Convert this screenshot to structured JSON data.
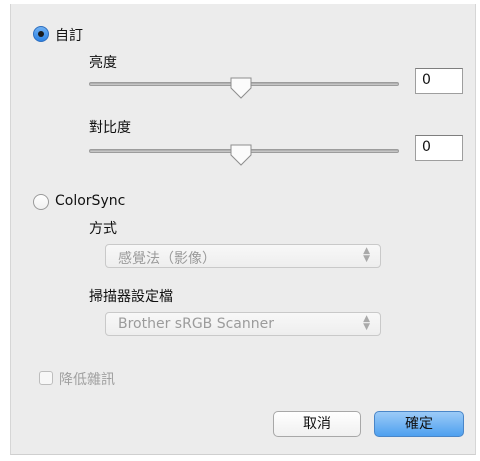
{
  "custom": {
    "label": "自訂",
    "selected": true,
    "brightness": {
      "label": "亮度",
      "value": "0",
      "slider_fraction": 0.5
    },
    "contrast": {
      "label": "對比度",
      "value": "0",
      "slider_fraction": 0.5
    }
  },
  "colorsync": {
    "label": "ColorSync",
    "selected": false,
    "method": {
      "label": "方式",
      "selected_option": "感覺法（影像）"
    },
    "scanner_profile": {
      "label": "掃描器設定檔",
      "selected_option": "Brother sRGB Scanner"
    }
  },
  "noise_reduction": {
    "label": "降低雜訊",
    "checked": false
  },
  "buttons": {
    "cancel": "取消",
    "ok": "確定"
  },
  "colors": {
    "accent": "#4ea0ef",
    "panel": "#ececec",
    "disabled_text": "#9b9b9b"
  }
}
